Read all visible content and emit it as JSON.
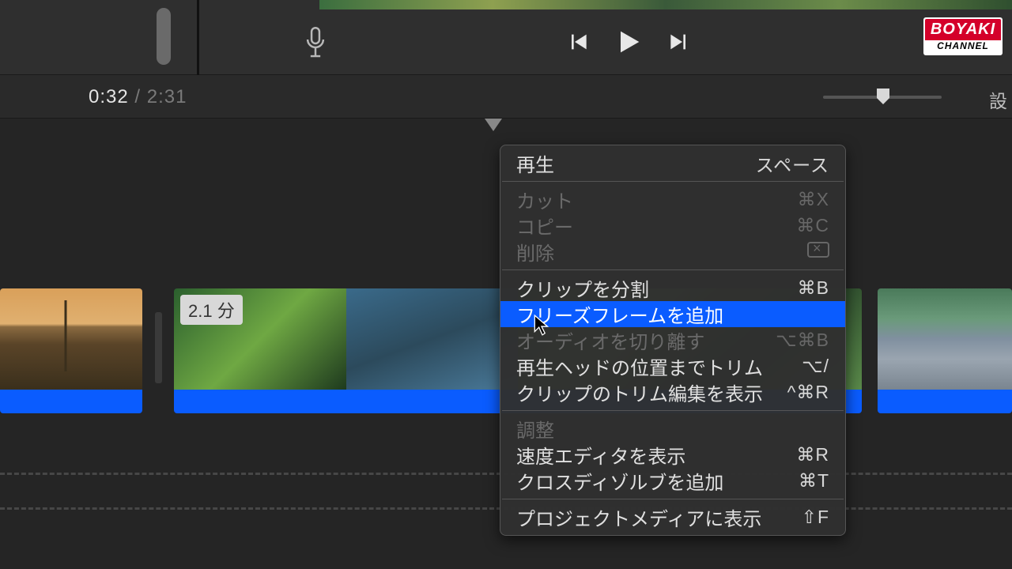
{
  "playback": {
    "current_time": "0:32",
    "separator": " / ",
    "total_time": "2:31"
  },
  "toolbar": {
    "settings_label": "設"
  },
  "clips": {
    "clip2_duration_badge": "2.1 分"
  },
  "context_menu": {
    "play": {
      "label": "再生",
      "shortcut": "スペース"
    },
    "cut": {
      "label": "カット",
      "shortcut": "⌘X"
    },
    "copy": {
      "label": "コピー",
      "shortcut": "⌘C"
    },
    "delete": {
      "label": "削除"
    },
    "split_clip": {
      "label": "クリップを分割",
      "shortcut": "⌘B"
    },
    "add_freeze_frame": {
      "label": "フリーズフレームを追加"
    },
    "detach_audio": {
      "label": "オーディオを切り離す",
      "shortcut": "⌥⌘B"
    },
    "trim_to_playhead": {
      "label": "再生ヘッドの位置までトリム",
      "shortcut": "⌥/"
    },
    "show_clip_trimmer": {
      "label": "クリップのトリム編集を表示",
      "shortcut": "^⌘R"
    },
    "adjust_header": {
      "label": "調整"
    },
    "show_speed_editor": {
      "label": "速度エディタを表示",
      "shortcut": "⌘R"
    },
    "add_cross_dissolve": {
      "label": "クロスディゾルブを追加",
      "shortcut": "⌘T"
    },
    "reveal_in_project_media": {
      "label": "プロジェクトメディアに表示",
      "shortcut": "⇧F"
    }
  },
  "logo": {
    "top": "BOYAKI",
    "bottom": "CHANNEL"
  }
}
